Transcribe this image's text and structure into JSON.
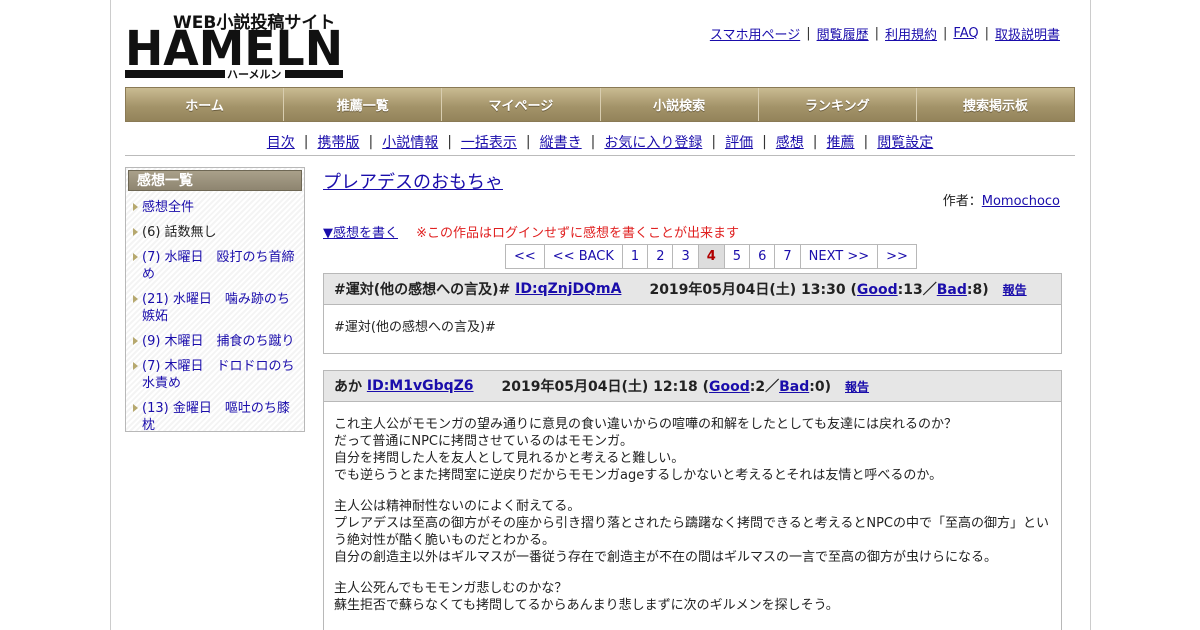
{
  "logo": {
    "tagline": "WEB小説投稿サイト",
    "name": "HAMELN",
    "kana": "ハーメルン"
  },
  "top_links": [
    "スマホ用ページ",
    "閲覧履歴",
    "利用規約",
    "FAQ",
    "取扱説明書"
  ],
  "main_nav": [
    "ホーム",
    "推薦一覧",
    "マイページ",
    "小説検索",
    "ランキング",
    "捜索掲示板"
  ],
  "sub_nav": [
    "目次",
    "携帯版",
    "小説情報",
    "一括表示",
    "縦書き",
    "お気に入り登録",
    "評価",
    "感想",
    "推薦",
    "閲覧設定"
  ],
  "sidebar": {
    "heading": "感想一覧",
    "items": [
      {
        "label": "感想全件",
        "link": true
      },
      {
        "label": "(6) 話数無し",
        "link": false
      },
      {
        "label": "(7) 水曜日　殴打のち首締め",
        "link": true
      },
      {
        "label": "(21) 水曜日　噛み跡のち嫉妬",
        "link": true
      },
      {
        "label": "(9) 木曜日　捕食のち蹴り",
        "link": true
      },
      {
        "label": "(7) 木曜日　ドロドロのち水責め",
        "link": true
      },
      {
        "label": "(13) 金曜日　嘔吐のち膝枕",
        "link": true
      }
    ]
  },
  "novel": {
    "title": "プレアデスのおもちゃ",
    "author_label": "作者：",
    "author": "Momochoco"
  },
  "write_link": "▼感想を書く",
  "login_warning": "※この作品はログインせずに感想を書くことが出来ます",
  "pager": {
    "items": [
      "<<",
      "<< BACK",
      "1",
      "2",
      "3",
      "4",
      "5",
      "6",
      "7",
      "NEXT >>",
      ">>"
    ],
    "current": "4"
  },
  "comments": [
    {
      "name": "#運対(他の感想への言及)#",
      "id": "ID:qZnjDQmA",
      "date": "2019年05月04日(土) 13:30",
      "good_label": "Good",
      "good": "13",
      "bad_label": "Bad",
      "bad": "8",
      "report": "報告",
      "body": [
        "#運対(他の感想への言及)#"
      ]
    },
    {
      "name": "あか",
      "id": "ID:M1vGbqZ6",
      "date": "2019年05月04日(土) 12:18",
      "good_label": "Good",
      "good": "2",
      "bad_label": "Bad",
      "bad": "0",
      "report": "報告",
      "body": [
        "これ主人公がモモンガの望み通りに意見の食い違いからの喧嘩の和解をしたとしても友達には戻れるのか？\nだって普通にNPCに拷問させているのはモモンガ。\n自分を拷問した人を友人として見れるかと考えると難しい。\nでも逆らうとまた拷問室に逆戻りだからモモンガageするしかないと考えるとそれは友情と呼べるのか。",
        "主人公は精神耐性ないのによく耐えてる。\nプレアデスは至高の御方がその座から引き摺り落とされたら躊躇なく拷問できると考えるとNPCの中で「至高の御方」という絶対性が酷く脆いものだとわかる。\n自分の創造主以外はギルマスが一番従う存在で創造主が不在の間はギルマスの一言で至高の御方が虫けらになる。",
        "主人公死んでもモモンガ悲しむのかな？\n蘇生拒否で蘇らなくても拷問してるからあんまり悲しまずに次のギルメンを探しそう。"
      ]
    }
  ]
}
